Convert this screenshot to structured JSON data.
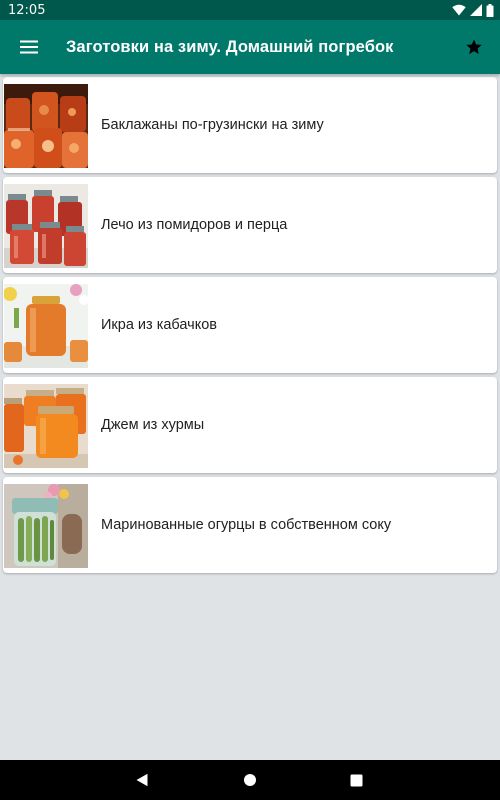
{
  "status_bar": {
    "time": "12:05"
  },
  "app_bar": {
    "title": "Заготовки на зиму. Домашний погребок",
    "menu_icon": "hamburger-menu-icon",
    "favorite_icon": "star-icon"
  },
  "recipes": [
    {
      "title": "Баклажаны по-грузински на зиму",
      "image": "eggplant-jars-photo"
    },
    {
      "title": "Лечо из помидоров и перца",
      "image": "lecho-jars-photo"
    },
    {
      "title": "Икра из кабачков",
      "image": "zucchini-caviar-jar-photo"
    },
    {
      "title": "Джем из хурмы",
      "image": "persimmon-jam-jars-photo"
    },
    {
      "title": "Маринованные огурцы в собственном соку",
      "image": "pickled-cucumbers-jar-photo"
    }
  ],
  "nav_bar": {
    "back_icon": "back-triangle-icon",
    "home_icon": "home-circle-icon",
    "recents_icon": "recents-square-icon"
  },
  "colors": {
    "status_bar": "#00574b",
    "app_bar": "#00796b",
    "background": "#dfe3e6",
    "card": "#ffffff",
    "text": "#212121"
  }
}
